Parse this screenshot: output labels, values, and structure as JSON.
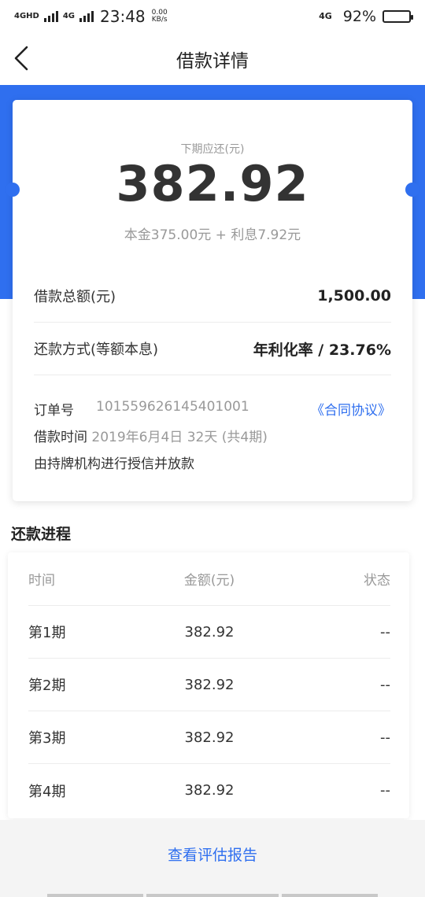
{
  "status_bar": {
    "signal1": "4GHD",
    "signal2": "4G",
    "time": "23:48",
    "speed_value": "0.00",
    "speed_unit": "KB/s",
    "network_right": "4G",
    "battery_percent": "92%",
    "battery_level": 0.92
  },
  "header": {
    "title": "借款详情"
  },
  "summary": {
    "next_label": "下期应还(元)",
    "next_amount": "382.92",
    "breakdown": "本金375.00元 + 利息7.92元",
    "total_label": "借款总额(元)",
    "total_value": "1,500.00",
    "method_label": "还款方式(等额本息)",
    "rate_value": "年利化率 / 23.76%",
    "order_label": "订单号",
    "order_number": "101559626145401001",
    "contract_link": "《合同协议》",
    "loan_time_label": "借款时间",
    "loan_time_value": "2019年6月4日 32天 (共4期)",
    "note": "由持牌机构进行授信并放款"
  },
  "progress": {
    "title": "还款进程",
    "headers": [
      "时间",
      "金额(元)",
      "状态"
    ],
    "rows": [
      {
        "period": "第1期",
        "amount": "382.92",
        "status": "--"
      },
      {
        "period": "第2期",
        "amount": "382.92",
        "status": "--"
      },
      {
        "period": "第3期",
        "amount": "382.92",
        "status": "--"
      },
      {
        "period": "第4期",
        "amount": "382.92",
        "status": "--"
      }
    ]
  },
  "footer": {
    "report_link": "查看评估报告"
  },
  "colors": {
    "accent": "#2f6fef"
  }
}
